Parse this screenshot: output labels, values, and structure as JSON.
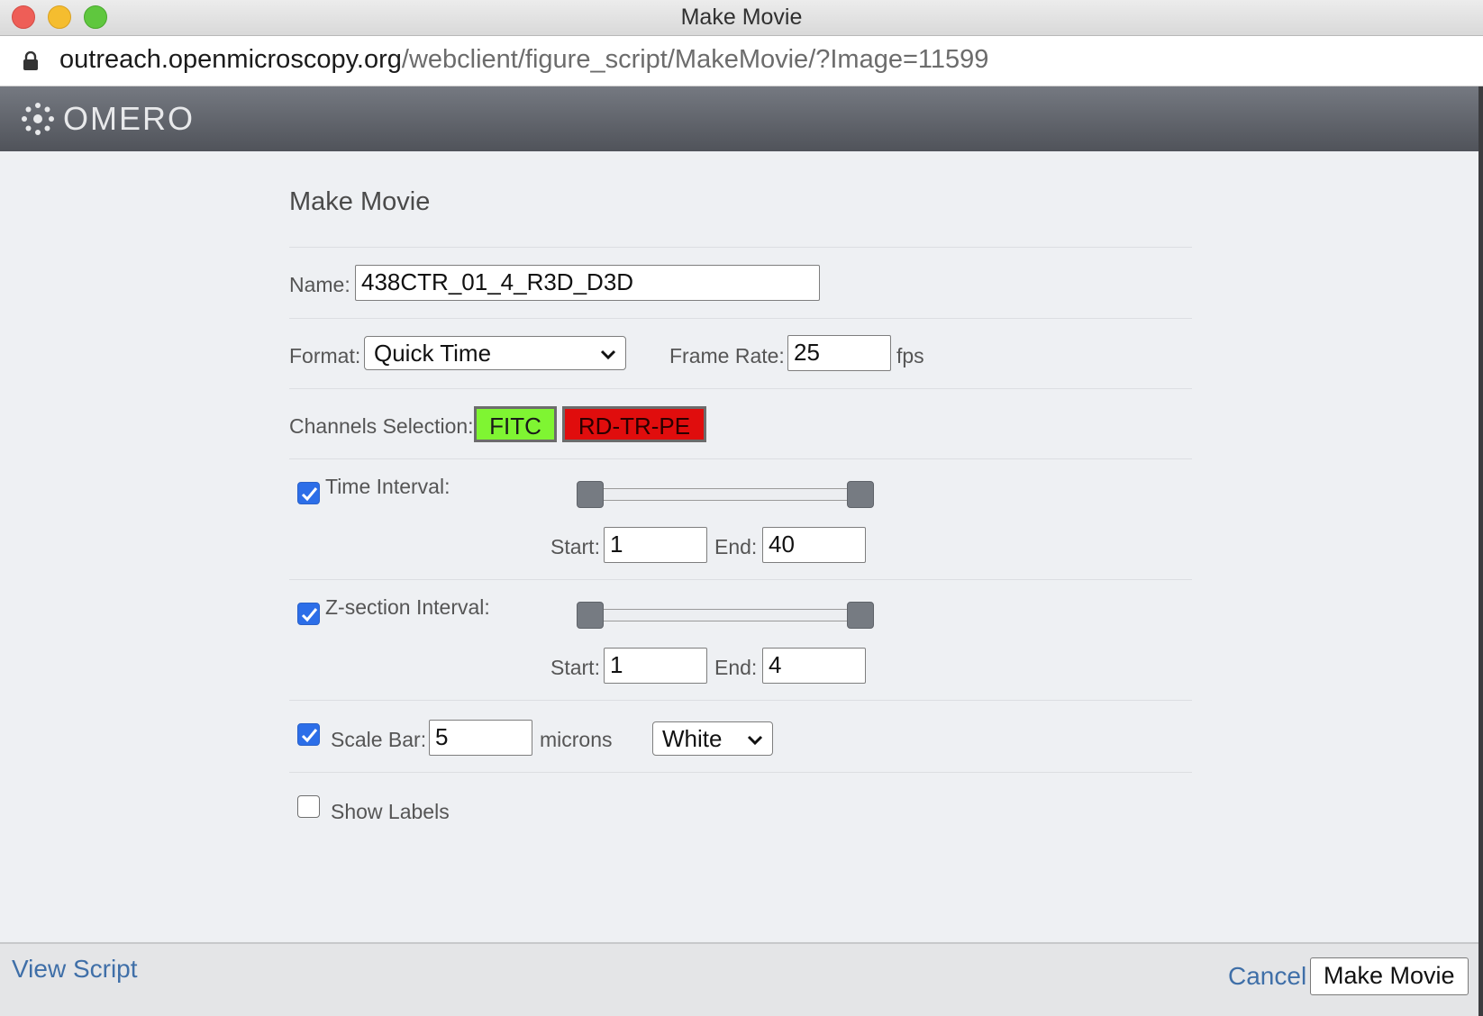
{
  "window": {
    "title": "Make Movie"
  },
  "browser": {
    "url_host": "outreach.openmicroscopy.org",
    "url_path": "/webclient/figure_script/MakeMovie/?Image=11599"
  },
  "app": {
    "logo_text": "OMERO"
  },
  "form": {
    "title": "Make Movie",
    "name_label": "Name:",
    "name_value": "438CTR_01_4_R3D_D3D",
    "format_label": "Format:",
    "format_value": "Quick Time",
    "frame_rate_label": "Frame Rate:",
    "frame_rate_value": "25",
    "frame_rate_unit": "fps",
    "channels_label": "Channels Selection:",
    "channels": [
      {
        "name": "FITC",
        "color": "#7ff532",
        "text_color": "#1a1a1a"
      },
      {
        "name": "RD-TR-PE",
        "color": "#e00d0d",
        "text_color": "#2a0000"
      }
    ],
    "time_interval": {
      "label": "Time Interval:",
      "checked": true,
      "start_label": "Start:",
      "start_value": "1",
      "end_label": "End:",
      "end_value": "40"
    },
    "z_interval": {
      "label": "Z-section Interval:",
      "checked": true,
      "start_label": "Start:",
      "start_value": "1",
      "end_label": "End:",
      "end_value": "4"
    },
    "scale_bar": {
      "label": "Scale Bar:",
      "checked": true,
      "value": "5",
      "unit": "microns",
      "color_value": "White"
    },
    "show_labels": {
      "label": "Show Labels",
      "checked": false
    }
  },
  "footer": {
    "view_script": "View Script",
    "cancel": "Cancel",
    "make_movie": "Make Movie"
  },
  "colors": {
    "checkbox_blue": "#2c6ee8",
    "link_blue": "#3f6fa8",
    "header_gray": "#5e6168"
  }
}
